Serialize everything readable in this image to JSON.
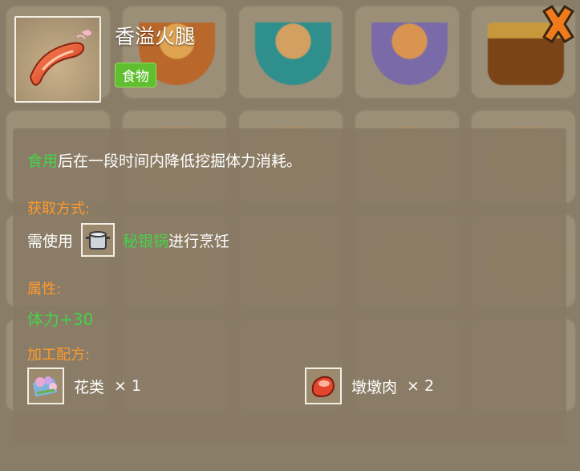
{
  "item": {
    "name": "香溢火腿",
    "tag": "食物",
    "icon": "ham-sausage-icon"
  },
  "description": {
    "verb": "食用",
    "rest": "后在一段时间内降低挖掘体力消耗。"
  },
  "acquire": {
    "heading": "获取方式:",
    "prefix": "需使用",
    "tool": "秘银锅",
    "suffix": "进行烹饪",
    "tool_icon": "pot-icon"
  },
  "attributes": {
    "heading": "属性:",
    "value": "体力+30"
  },
  "recipe": {
    "heading": "加工配方:",
    "ingredients": [
      {
        "name": "花类",
        "qty": "× 1",
        "icon": "flowers-icon"
      },
      {
        "name": "墩墩肉",
        "qty": "× 2",
        "icon": "meat-icon"
      }
    ]
  },
  "colors": {
    "green_text": "#45d34a",
    "orange_heading": "#ff9a2e",
    "tag_bg": "#5fbf2e",
    "close_orange": "#f07b1c"
  }
}
